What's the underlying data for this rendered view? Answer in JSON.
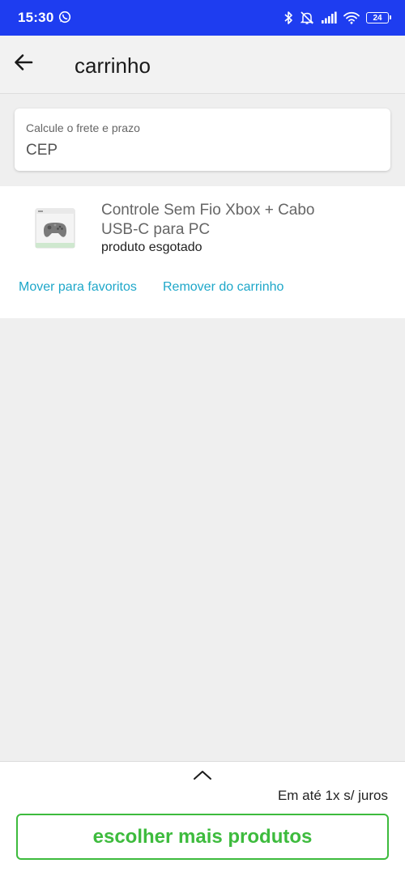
{
  "status_bar": {
    "time": "15:30",
    "battery": "24",
    "background_color": "#1e3df0",
    "icons": [
      "whatsapp-icon",
      "bluetooth-icon",
      "alarm-off-icon",
      "signal-icon",
      "wifi-icon",
      "battery-icon"
    ]
  },
  "header": {
    "title": "carrinho",
    "back_icon": "arrow-left-icon"
  },
  "shipping": {
    "label": "Calcule o frete e prazo",
    "placeholder": "CEP",
    "value": ""
  },
  "cart": {
    "items": [
      {
        "name": "Controle Sem Fio Xbox + Cabo USB-C para PC",
        "status": "produto esgotado",
        "image_icon": "xbox-controller-box-image",
        "actions": {
          "favorite_label": "Mover para favoritos",
          "remove_label": "Remover do carrinho"
        }
      }
    ]
  },
  "footer": {
    "expand_icon": "chevron-up-icon",
    "installments": "Em até 1x s/ juros",
    "cta_label": "escolher mais produtos",
    "accent_color": "#3dbb3d",
    "link_color": "#1ea7c9"
  }
}
